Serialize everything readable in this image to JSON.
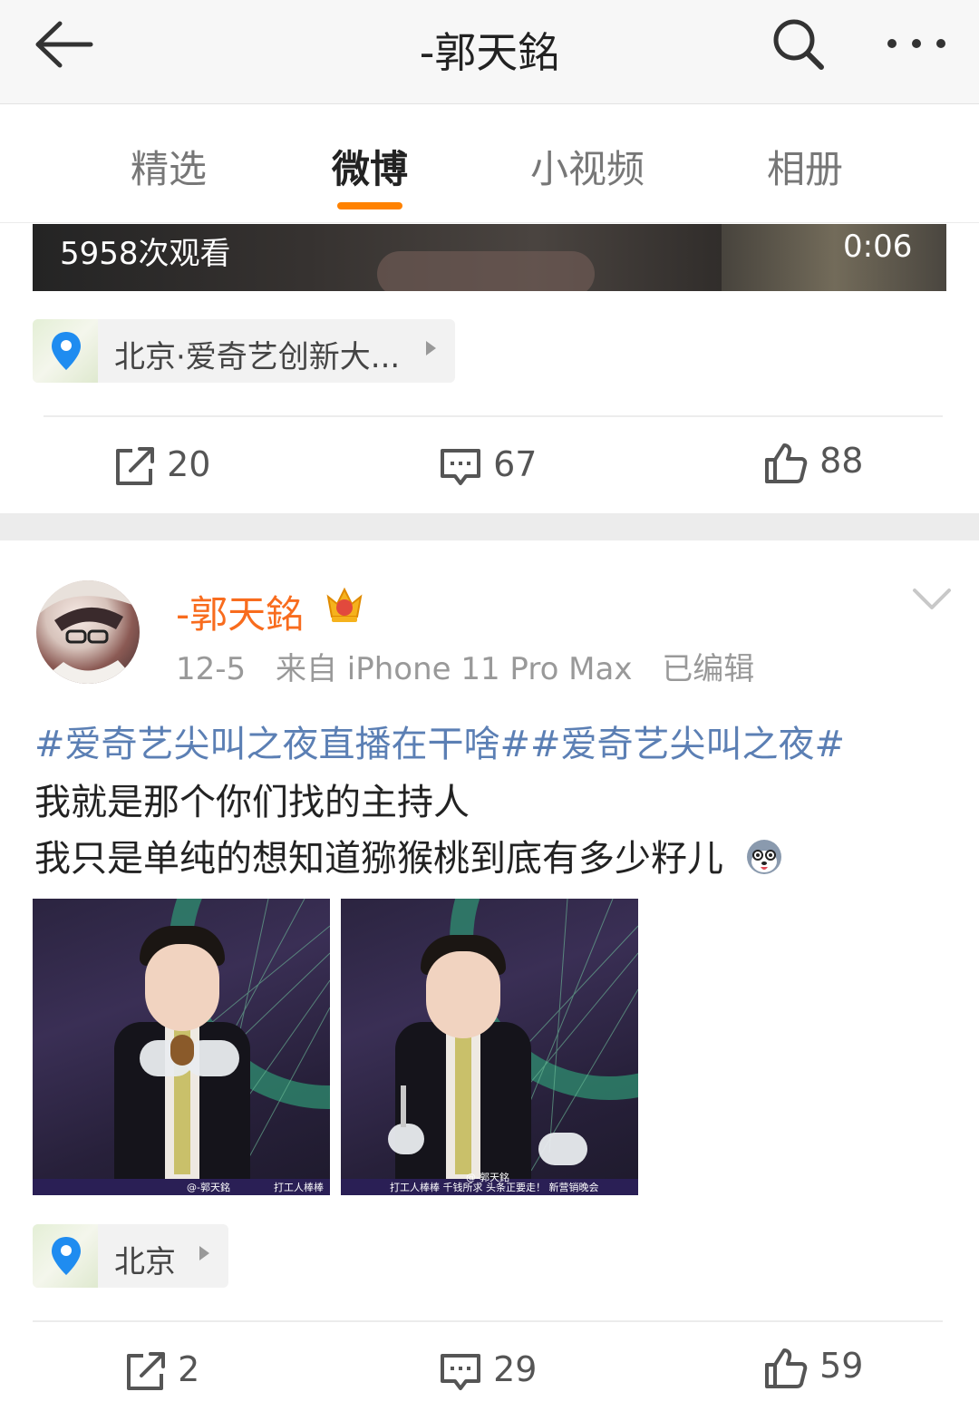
{
  "header": {
    "title": "-郭天銘"
  },
  "tabs": [
    {
      "label": "精选"
    },
    {
      "label": "微博"
    },
    {
      "label": "小视频"
    },
    {
      "label": "相册"
    }
  ],
  "prev_post": {
    "video": {
      "views": "5958次观看",
      "duration": "0:06"
    },
    "location": "北京·爱奇艺创新大...",
    "actions": {
      "repost": "20",
      "comment": "67",
      "like": "88"
    }
  },
  "post": {
    "author": "-郭天銘",
    "date": "12-5",
    "source": "来自 iPhone 11 Pro Max",
    "edited": "已编辑",
    "topics": "#爱奇艺尖叫之夜直播在干啥##爱奇艺尖叫之夜#",
    "line1": "我就是那个你们找的主持人",
    "line2": "我只是单纯的想知道猕猴桃到底有多少籽儿",
    "photos": [
      {
        "watermark": "@-郭天銘",
        "banner": "打工人棒棒"
      },
      {
        "watermark": "@-郭天銘",
        "banner": "打工人棒棒 千钱所求 头条正要走！ 新营销晚会"
      }
    ],
    "location": "北京",
    "actions": {
      "repost": "2",
      "comment": "29",
      "like": "59"
    }
  },
  "colors": {
    "accent": "#ff8200",
    "username": "#f86c1e",
    "topic": "#5b7fb4"
  },
  "icons": [
    "back-arrow-icon",
    "search-icon",
    "more-icon",
    "location-pin-icon",
    "repost-icon",
    "comment-icon",
    "like-icon",
    "crown-badge-icon",
    "chevron-down-icon",
    "emoji-husky-icon"
  ]
}
